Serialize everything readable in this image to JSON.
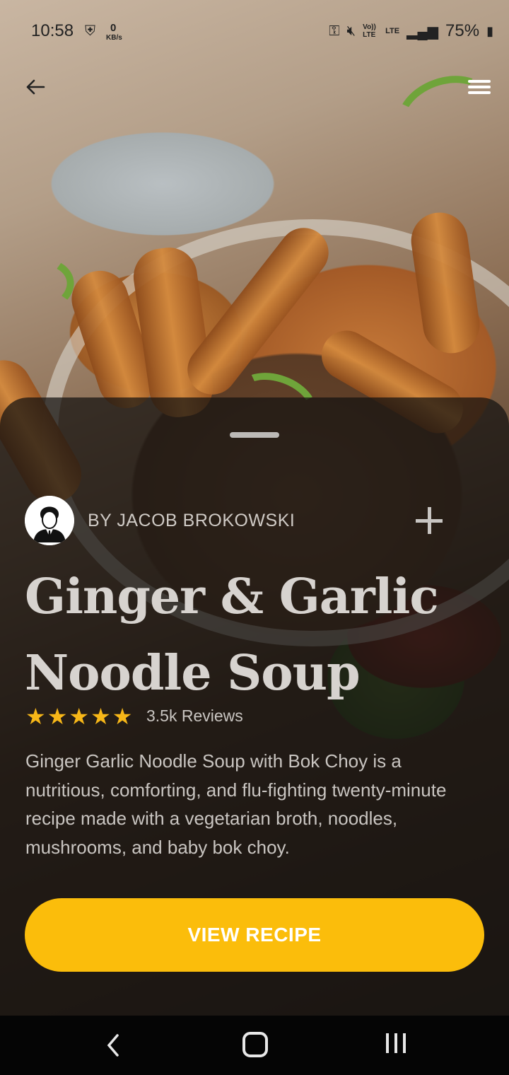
{
  "status_bar": {
    "time": "10:58",
    "data_speed_value": "0",
    "data_speed_unit": "KB/s",
    "volte_label": "Vo)) LTE",
    "lte_label": "LTE",
    "battery": "75%"
  },
  "icons": {
    "back": "arrow-left-icon",
    "menu": "hamburger-menu-icon",
    "add": "plus-icon",
    "star": "star-icon"
  },
  "recipe": {
    "author": "BY JACOB BROKOWSKI",
    "title_line1": "Ginger & Garlic",
    "title_line2": "Noodle Soup",
    "rating": 5,
    "reviews": "3.5k Reviews",
    "description": "Ginger Garlic Noodle Soup with Bok Choy is a nutritious, comforting, and flu-fighting twenty-minute recipe made with a vegetarian broth, noodles, mushrooms, and baby bok choy.",
    "cta_label": "VIEW RECIPE"
  },
  "colors": {
    "accent": "#fbbd0b",
    "star": "#f7b718",
    "sheet": "#141210"
  }
}
